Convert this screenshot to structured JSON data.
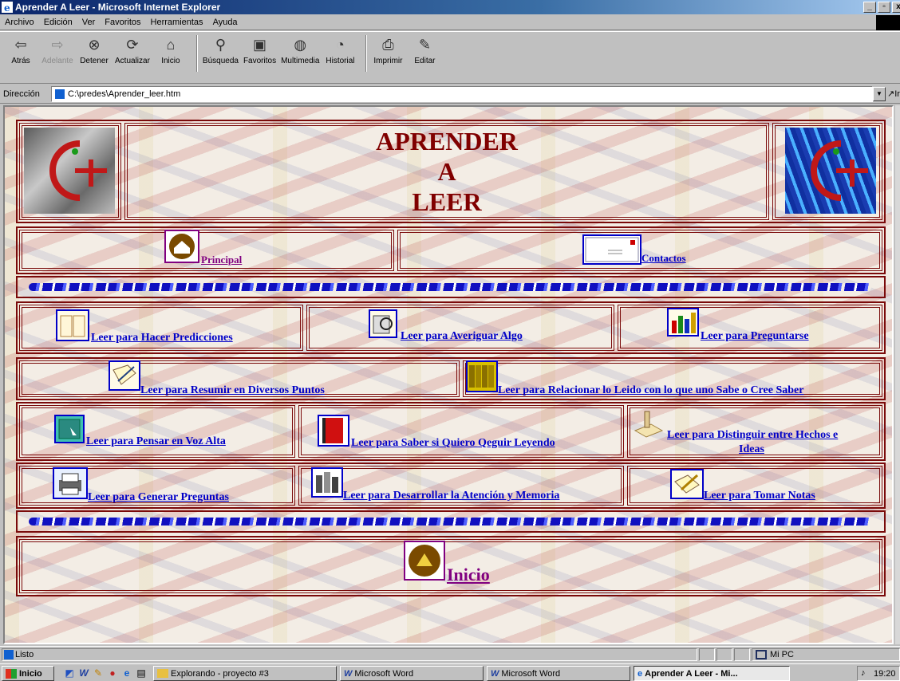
{
  "window": {
    "title": "Aprender A Leer - Microsoft Internet Explorer",
    "controls": [
      "_",
      "▫",
      "x"
    ]
  },
  "menu": [
    "Archivo",
    "Edición",
    "Ver",
    "Favoritos",
    "Herramientas",
    "Ayuda"
  ],
  "toolbar": [
    {
      "label": "Atrás",
      "icon": "back-arrow-icon"
    },
    {
      "label": "Adelante",
      "icon": "forward-arrow-icon"
    },
    {
      "label": "Detener",
      "icon": "stop-icon"
    },
    {
      "label": "Actualizar",
      "icon": "refresh-icon"
    },
    {
      "label": "Inicio",
      "icon": "home-icon"
    },
    {
      "label": "Búsqueda",
      "icon": "search-icon"
    },
    {
      "label": "Favoritos",
      "icon": "favorites-icon"
    },
    {
      "label": "Multimedia",
      "icon": "multimedia-icon"
    },
    {
      "label": "Historial",
      "icon": "history-icon"
    },
    {
      "label": "Imprimir",
      "icon": "print-icon"
    },
    {
      "label": "Editar",
      "icon": "edit-icon"
    }
  ],
  "address": {
    "label": "Dirección",
    "value": "C:\\predes\\Aprender_leer.htm",
    "go": "Ir"
  },
  "page": {
    "heading_lines": [
      "APRENDER",
      "A",
      "LEER"
    ],
    "nav": {
      "principal": "Principal",
      "contactos": "Contactos"
    },
    "links": [
      "Leer para Hacer Predicciones",
      "Leer para Averiguar Algo",
      "Leer para Preguntarse",
      "Leer para Resumir en Diversos Puntos",
      "Leer para Relacionar lo Leido con lo que uno Sabe o Cree Saber",
      "Leer para Pensar en Voz Alta",
      "Leer para Saber si Quiero Qeguir Leyendo",
      "Leer para Distinguir entre Hechos e",
      "Ideas",
      "Leer para Generar Preguntas",
      "Leer para Desarrollar la Atención y Memoria",
      "Leer para Tomar Notas"
    ],
    "inicio": "Inicio"
  },
  "status": {
    "text": "Listo",
    "zone": "Mi PC"
  },
  "taskbar": {
    "start": "Inicio",
    "items": [
      "Explorando - proyecto #3",
      "Microsoft Word",
      "Microsoft Word",
      "Aprender A Leer - Mi..."
    ],
    "clock": "19:20"
  },
  "colors": {
    "heading": "#800000",
    "link": "#0000c8",
    "visited": "#800080",
    "frame": "#7a0a0a"
  }
}
